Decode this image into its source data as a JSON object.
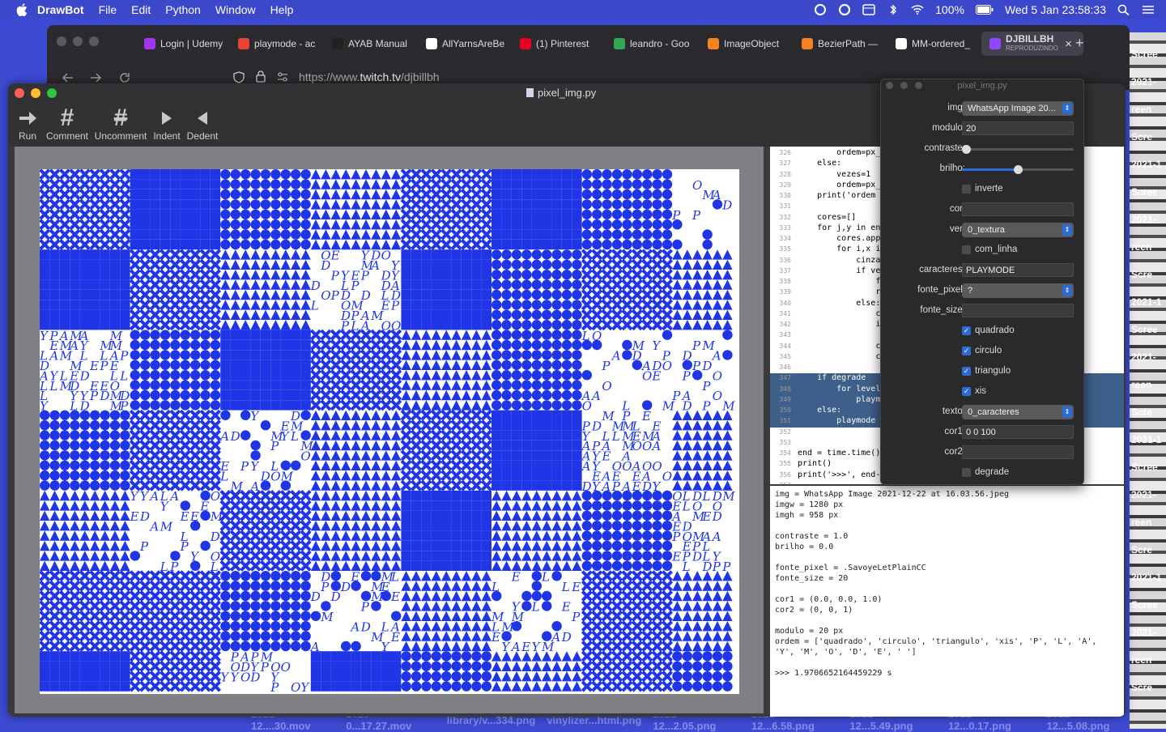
{
  "menubar": {
    "app": "DrawBot",
    "items": [
      "File",
      "Edit",
      "Python",
      "Window",
      "Help"
    ],
    "battery": "100%",
    "clock": "Wed 5 Jan  23:58:33"
  },
  "browser": {
    "tabs": [
      {
        "label": "Login | Udemy",
        "color": "#a435f0"
      },
      {
        "label": "playmode - ac",
        "color": "#ea4335"
      },
      {
        "label": "AYAB Manual",
        "color": "#222222"
      },
      {
        "label": "AllYarnsAreBe",
        "color": "#ffffff"
      },
      {
        "label": "(1) Pinterest",
        "color": "#e60023"
      },
      {
        "label": "leandro - Goo",
        "color": "#34a853"
      },
      {
        "label": "ImageObject",
        "color": "#f58220"
      },
      {
        "label": "BezierPath —",
        "color": "#f58220"
      },
      {
        "label": "MM-ordered_",
        "color": "#ffffff"
      },
      {
        "label": "DJBILLBH",
        "sub": "REPRODUZINDO",
        "color": "#9146ff"
      }
    ],
    "url_prefix": "https://www.",
    "url_domain": "twitch.tv",
    "url_path": "/djbillbh"
  },
  "drawbot": {
    "title": "pixel_img.py",
    "toolbar": [
      {
        "label": "Run",
        "icon": "run-arrow-icon"
      },
      {
        "label": "Comment",
        "icon": "hash-icon"
      },
      {
        "label": "Uncomment",
        "icon": "uncomment-hash-icon"
      },
      {
        "label": "Indent",
        "icon": "indent-icon"
      },
      {
        "label": "Dedent",
        "icon": "dedent-icon"
      }
    ],
    "art_color": "#1f35e6"
  },
  "code": {
    "lines": [
      {
        "n": "326",
        "t": "        ordem=px_"
      },
      {
        "n": "327",
        "t": "    else:"
      },
      {
        "n": "328",
        "t": "        vezes=1"
      },
      {
        "n": "329",
        "t": "        ordem=px_"
      },
      {
        "n": "330",
        "t": "    print('ordem"
      },
      {
        "n": "331",
        "t": ""
      },
      {
        "n": "332",
        "t": "    cores=[]"
      },
      {
        "n": "333",
        "t": "    for j,y in en"
      },
      {
        "n": "334",
        "t": "        cores.app"
      },
      {
        "n": "335",
        "t": "        for i,x i"
      },
      {
        "n": "336",
        "t": "            cinza"
      },
      {
        "n": "337",
        "t": "            if ve"
      },
      {
        "n": "338",
        "t": "                f"
      },
      {
        "n": "339",
        "t": "                r"
      },
      {
        "n": "340",
        "t": "            else:"
      },
      {
        "n": "341",
        "t": "                c"
      },
      {
        "n": "342",
        "t": "                i"
      },
      {
        "n": "343",
        "t": ""
      },
      {
        "n": "344",
        "t": "                c"
      },
      {
        "n": "345",
        "t": "                c"
      },
      {
        "n": "346",
        "t": ""
      },
      {
        "n": "347",
        "t": "    if degrade",
        "hl": true
      },
      {
        "n": "348",
        "t": "        for level",
        "hl": true
      },
      {
        "n": "349",
        "t": "            playm",
        "hl": true
      },
      {
        "n": "350",
        "t": "    else:",
        "hl": true
      },
      {
        "n": "351",
        "t": "        playmode",
        "hl": true
      },
      {
        "n": "352",
        "t": ""
      },
      {
        "n": "353",
        "t": ""
      },
      {
        "n": "354",
        "t": "end = time.time()"
      },
      {
        "n": "355",
        "t": "print()"
      },
      {
        "n": "356",
        "t": "print('>>>', end-"
      },
      {
        "n": "357",
        "t": ""
      }
    ]
  },
  "output": {
    "lines": [
      "img = WhatsApp Image 2021-12-22 at 16.03.56.jpeg",
      "imgw = 1280 px",
      "imgh = 958 px",
      "",
      "contraste = 1.0",
      "brilho = 0.0",
      "",
      "fonte_pixel = .SavoyeLetPlainCC",
      "fonte_size = 20",
      "",
      "cor1 = (0.0, 0.0, 1.0)",
      "cor2 = (0, 0, 1)",
      "",
      "modulo = 20 px",
      "ordem = ['quadrado', 'circulo', 'triangulo', 'xis', 'P', 'L', 'A',",
      "'Y', 'M', 'O', 'D', 'E', ' ']",
      "",
      ">>> 1.9706652164459229 s"
    ]
  },
  "panel": {
    "title": "pixel_img.py",
    "img_label": "img:",
    "img_value": "WhatsApp Image 20...",
    "modulo_label": "modulo:",
    "modulo_value": "20",
    "contraste_label": "contraste:",
    "contraste_level": 0.0,
    "brilho_label": "brilho:",
    "brilho_level": 0.5,
    "inverte_label": "inverte",
    "inverte_checked": false,
    "cor_label": "cor:",
    "cor_value": "",
    "ver_label": "ver:",
    "ver_value": "0_textura",
    "com_linha_label": "com_linha",
    "com_linha_checked": false,
    "caracteres_label": "caracteres:",
    "caracteres_value": "PLAYMODE",
    "fonte_pixel_label": "fonte_pixel:",
    "fonte_pixel_value": "?",
    "fonte_size_label": "fonte_size:",
    "fonte_size_value": "",
    "quadrado_label": "quadrado",
    "quadrado_checked": true,
    "circulo_label": "circulo",
    "circulo_checked": true,
    "triangulo_label": "triangulo",
    "triangulo_checked": true,
    "xis_label": "xis",
    "xis_checked": true,
    "texto_label": "texto:",
    "texto_value": "0_caracteres",
    "cor1_label": "cor1:",
    "cor1_value": "0 0 100",
    "cor2_label": "cor2:",
    "cor2_value": "",
    "degrade_label": "degrade",
    "degrade_checked": false
  },
  "desktop": {
    "strip_labels": [
      "Scree",
      "2021-",
      "reen",
      "Scre",
      "2021-1"
    ],
    "files": [
      "2021-12....30.mov",
      "2020-0...17.27.mov",
      "library/v...334.png",
      "vinylizer...html.png",
      "2021-12...2.05.png",
      "2021-12...6.58.png",
      "2021-12...5.49.png",
      "2021-12...0.17.png",
      "2021-12...5.08.png"
    ]
  }
}
